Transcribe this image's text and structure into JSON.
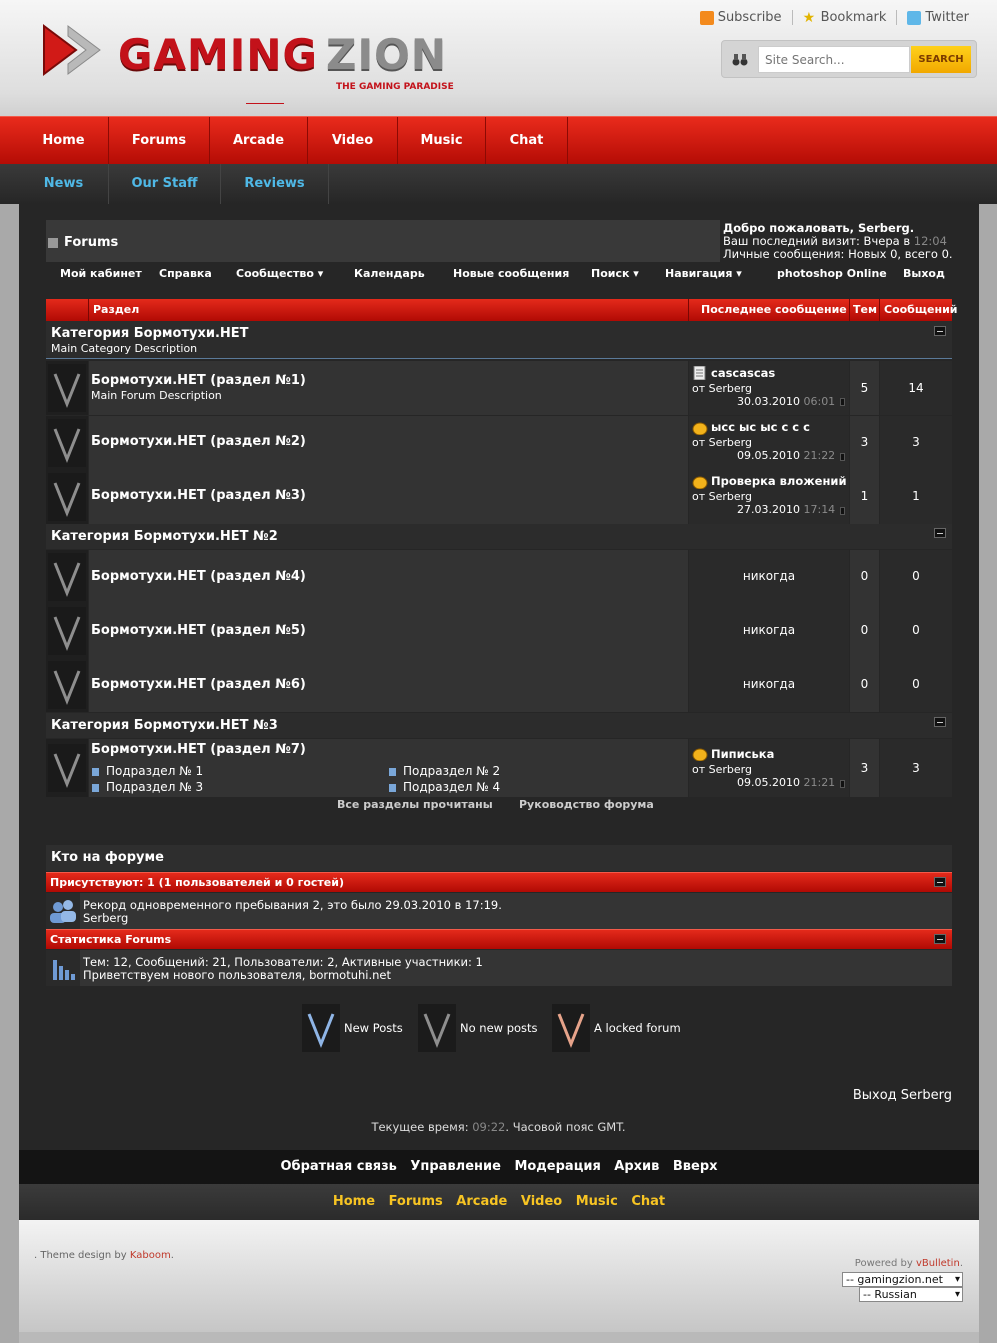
{
  "header": {
    "logo_part1": "GAMING",
    "logo_part2": "ZION",
    "tagline": "THE GAMING PARADISE",
    "toplinks": [
      "Subscribe",
      "Bookmark",
      "Twitter"
    ],
    "search_placeholder": "Site Search...",
    "search_button": "SEARCH"
  },
  "nav_main": [
    "Home",
    "Forums",
    "Arcade",
    "Video",
    "Music",
    "Chat"
  ],
  "nav_sub": [
    "News",
    "Our Staff",
    "Reviews"
  ],
  "navbar": {
    "title": "Forums",
    "welcome": "Добро пожаловать, Serberg.",
    "last_visit_label": "Ваш последний визит: Вчера в",
    "last_visit_time": "12:04",
    "pm": "Личные сообщения: Новых 0, всего 0.",
    "links": [
      "Мой кабинет",
      "Справка",
      "Сообщество ▾",
      "Календарь",
      "Новые сообщения",
      "Поиск ▾",
      "Навигация ▾",
      "photoshop Online",
      "Выход"
    ]
  },
  "table_headers": [
    "Раздел",
    "Последнее сообщение",
    "Тем",
    "Сообщений"
  ],
  "categories": [
    {
      "title": "Категория Бормотухи.НЕТ",
      "description": "Main Category Description",
      "forums": [
        {
          "title": "Бормотухи.НЕТ (раздел №1)",
          "description": "Main Forum Description",
          "last_title": "cascascas",
          "last_by": "от Serberg",
          "last_date": "30.03.2010",
          "last_time": "06:01",
          "threads": "5",
          "posts": "14"
        },
        {
          "title": "Бормотухи.НЕТ (раздел №2)",
          "description": "",
          "last_title": "ысс ыс ыс с с с",
          "last_by": "от Serberg",
          "last_date": "09.05.2010",
          "last_time": "21:22",
          "threads": "3",
          "posts": "3"
        },
        {
          "title": "Бормотухи.НЕТ (раздел №3)",
          "description": "",
          "last_title": "Проверка вложений",
          "last_by": "от Serberg",
          "last_date": "27.03.2010",
          "last_time": "17:14",
          "threads": "1",
          "posts": "1"
        }
      ]
    },
    {
      "title": "Категория Бормотухи.НЕТ №2",
      "forums": [
        {
          "title": "Бормотухи.НЕТ (раздел №4)",
          "never": "никогда",
          "threads": "0",
          "posts": "0"
        },
        {
          "title": "Бормотухи.НЕТ (раздел №5)",
          "never": "никогда",
          "threads": "0",
          "posts": "0"
        },
        {
          "title": "Бормотухи.НЕТ (раздел №6)",
          "never": "никогда",
          "threads": "0",
          "posts": "0"
        }
      ]
    },
    {
      "title": "Категория Бормотухи.НЕТ №3",
      "forums": [
        {
          "title": "Бормотухи.НЕТ (раздел №7)",
          "subforums": [
            "Подраздел № 1",
            "Подраздел № 2",
            "Подраздел № 3",
            "Подраздел № 4"
          ],
          "last_title": "Пиписька",
          "last_by": "от Serberg",
          "last_date": "09.05.2010",
          "last_time": "21:21",
          "threads": "3",
          "posts": "3"
        }
      ]
    }
  ],
  "table_links": [
    "Все разделы прочитаны",
    "Руководство форума"
  ],
  "whos_online": {
    "title": "Кто на форуме",
    "present_header": "Присутствуют: 1 (1 пользователей и 0 гостей)",
    "record": "Рекорд одновременного пребывания 2, это было 29.03.2010 в 17:19.",
    "users": "Serberg",
    "stats_header": "Статистика Forums",
    "stats": "Тем: 12, Сообщений: 21, Пользователи: 2, Активные участники: 1",
    "newest": "Приветствуем нового пользователя, bormotuhi.net"
  },
  "legend": [
    "New Posts",
    "No new posts",
    "A locked forum"
  ],
  "logout": "Выход Serberg",
  "current_time_label": "Текущее время:",
  "current_time": "09:22",
  "timezone": ". Часовой пояс GMT.",
  "footer_links": [
    "Обратная связь",
    "Управление",
    "Модерация",
    "Архив",
    "Вверх"
  ],
  "footer_nav": [
    "Home",
    "Forums",
    "Arcade",
    "Video",
    "Music",
    "Chat"
  ],
  "theme_prefix": ". Theme design by",
  "theme_author": "Kaboom",
  "theme_suffix": ".",
  "powered_prefix": "Powered by",
  "powered_name": "vBulletin",
  "powered_suffix": ".",
  "style_select": "-- gamingzion.net",
  "lang_select": "-- Russian",
  "colors": {
    "accent_red": "#c3121a",
    "link_blue": "#4fb8e6",
    "footer_gold": "#f7c423"
  }
}
